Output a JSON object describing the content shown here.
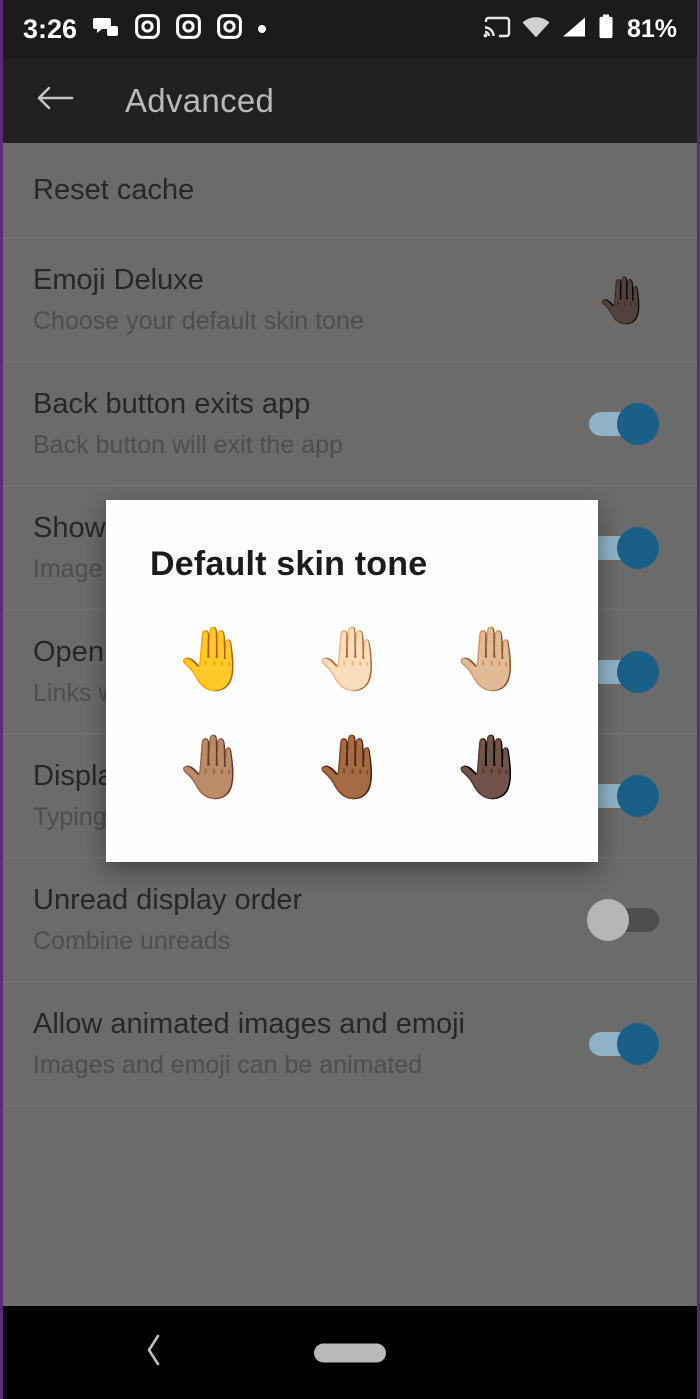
{
  "statusbar": {
    "time": "3:26",
    "battery_percent": "81%",
    "left_icons": [
      "chat-icon",
      "camera-icon",
      "camera-icon",
      "camera-icon",
      "dot-icon"
    ],
    "right_icons": [
      "cast-icon",
      "wifi-icon",
      "cellular-signal-icon",
      "battery-icon"
    ]
  },
  "appbar": {
    "back_icon": "arrow-left-icon",
    "title": "Advanced"
  },
  "settings": {
    "rows": [
      {
        "title": "Reset cache",
        "subtitle": "",
        "control": "none"
      },
      {
        "title": "Emoji Deluxe",
        "subtitle": "Choose your default skin tone",
        "control": "emoji",
        "emoji": "🤚🏿"
      },
      {
        "title": "Back button exits app",
        "subtitle": "Back button will exit the app",
        "control": "toggle",
        "toggle_on": true
      },
      {
        "title": "Show i",
        "subtitle": "Image p",
        "control": "toggle",
        "toggle_on": true
      },
      {
        "title": "Open w",
        "subtitle": "Links w",
        "control": "toggle",
        "toggle_on": true
      },
      {
        "title": "Display",
        "subtitle": "Typing i",
        "control": "toggle",
        "toggle_on": true
      },
      {
        "title": "Unread display order",
        "subtitle": "Combine unreads",
        "control": "toggle",
        "toggle_on": false
      },
      {
        "title": "Allow animated images and emoji",
        "subtitle": "Images and emoji can be animated",
        "control": "toggle",
        "toggle_on": true
      }
    ]
  },
  "dialog": {
    "title": "Default skin tone",
    "options": [
      {
        "name": "skin-tone-default",
        "emoji": "🤚"
      },
      {
        "name": "skin-tone-light",
        "emoji": "🤚🏻"
      },
      {
        "name": "skin-tone-medium-light",
        "emoji": "🤚🏼"
      },
      {
        "name": "skin-tone-medium",
        "emoji": "🤚🏽"
      },
      {
        "name": "skin-tone-medium-dark",
        "emoji": "🤚🏾"
      },
      {
        "name": "skin-tone-dark",
        "emoji": "🤚🏿"
      }
    ]
  },
  "navbar": {
    "back_icon": "chevron-left-icon",
    "home_icon": "home-pill-icon"
  },
  "colors": {
    "accent_toggle_on": "#1a5f88",
    "appbar_bg": "#212121",
    "statusbar_bg": "#1b1b1b",
    "scrim_bg": "#6b6b6b",
    "dialog_bg": "#fdfdfd"
  }
}
